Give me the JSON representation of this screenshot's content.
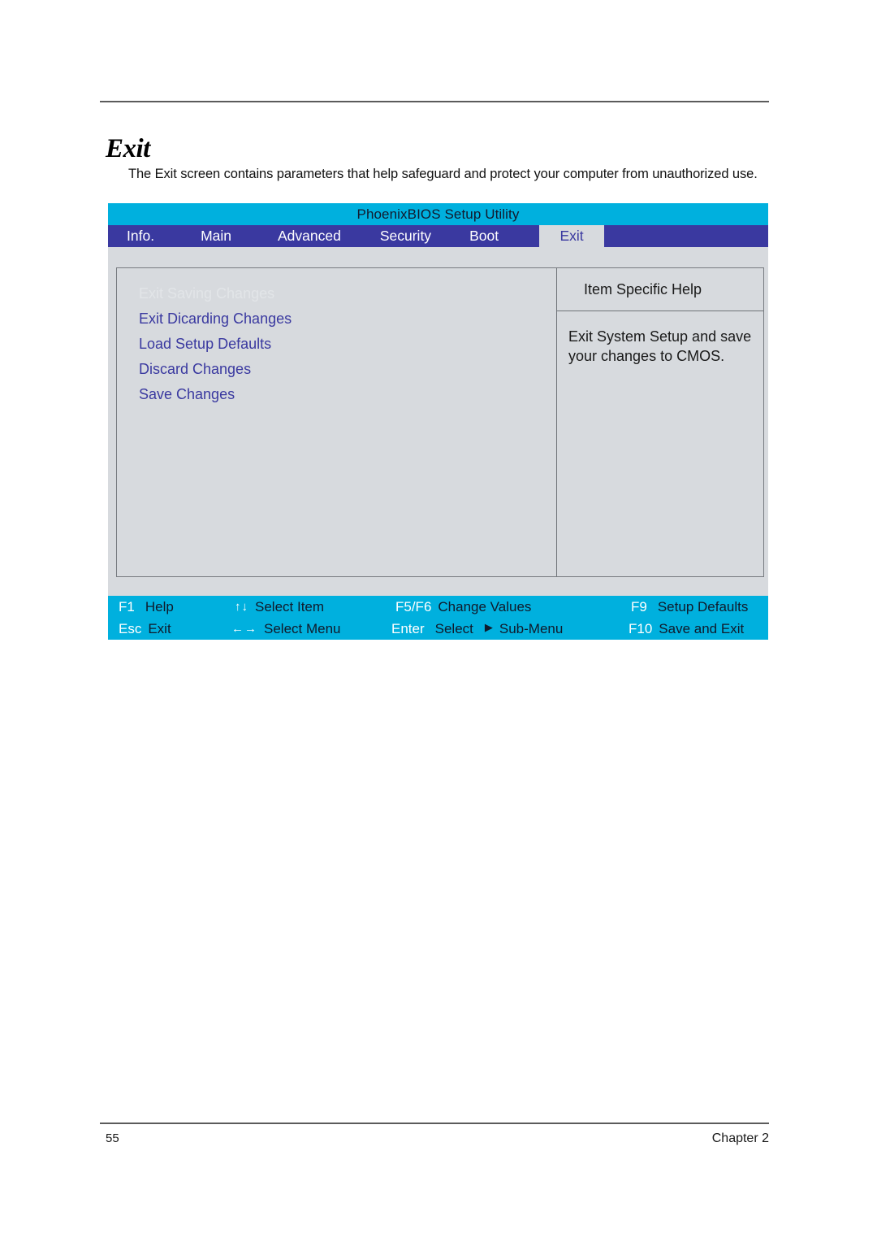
{
  "document": {
    "heading": "Exit",
    "intro": "The Exit screen contains parameters that help safeguard and protect your computer from unauthorized use.",
    "page_number": "55",
    "chapter": "Chapter 2"
  },
  "bios": {
    "title": "PhoenixBIOS Setup Utility",
    "colors": {
      "title_bar": "#00b0de",
      "menu_bar": "#3a39a0",
      "body": "#d7dade",
      "accent_text": "#3a39a0",
      "footer_bar": "#00b0de"
    },
    "menu_tabs": [
      {
        "label": "Info.",
        "active": false
      },
      {
        "label": "Main",
        "active": false
      },
      {
        "label": "Advanced",
        "active": false
      },
      {
        "label": "Security",
        "active": false
      },
      {
        "label": "Boot",
        "active": false
      },
      {
        "label": "Exit",
        "active": true
      }
    ],
    "settings": [
      {
        "label": "Exit Saving Changes",
        "selected": true
      },
      {
        "label": "Exit Dicarding Changes",
        "selected": false
      },
      {
        "label": "Load Setup Defaults",
        "selected": false
      },
      {
        "label": "Discard Changes",
        "selected": false
      },
      {
        "label": "Save Changes",
        "selected": false
      }
    ],
    "help": {
      "header": "Item Specific Help",
      "text": "Exit System Setup and save your changes to CMOS."
    },
    "function_keys": {
      "row1": [
        {
          "key": "F1",
          "desc": "Help"
        },
        {
          "key": "↑↓",
          "desc": "Select Item"
        },
        {
          "key": "F5/F6",
          "desc": "Change Values"
        },
        {
          "key": "F9",
          "desc": "Setup Defaults"
        }
      ],
      "row2": [
        {
          "key": "Esc",
          "desc": "Exit"
        },
        {
          "key": "←→",
          "desc": "Select Menu"
        },
        {
          "key": "Enter",
          "desc": "Select",
          "extra": "Sub-Menu",
          "triangle": "▶"
        },
        {
          "key": "F10",
          "desc": "Save and Exit"
        }
      ]
    }
  }
}
